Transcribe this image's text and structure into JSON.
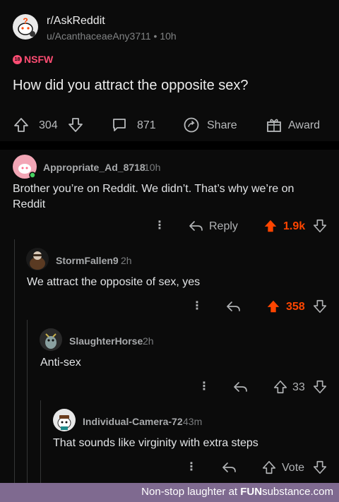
{
  "post": {
    "subreddit": "r/AskReddit",
    "author_meta": "u/AcanthaceaeAny3711 • 10h",
    "nsfw_label": "NSFW",
    "nsfw_badge": "18",
    "title": "How did you attract the opposite sex?",
    "votes": "304",
    "comments": "871",
    "share_label": "Share",
    "award_label": "Award"
  },
  "comments": [
    {
      "user": "Appropriate_Ad_8718",
      "time": "10h",
      "body": "Brother you’re on Reddit. We didn’t. That’s why we’re on Reddit",
      "reply_label": "Reply",
      "score": "1.9k"
    },
    {
      "user": "StormFallen9",
      "time": "2h",
      "body": "We attract the opposite of sex, yes",
      "score": "358"
    },
    {
      "user": "SlaughterHorse",
      "time": "2h",
      "body": "Anti-sex",
      "score": "33"
    },
    {
      "user": "Individual-Camera-72",
      "time": "43m",
      "body": "That sounds like virginity with extra steps",
      "score": "Vote"
    }
  ],
  "footer": {
    "text_prefix": "Non-stop laughter at ",
    "brand_fun": "FUN",
    "brand_rest": "substance",
    "brand_tld": ".com"
  },
  "colors": {
    "accent_upvote": "#ff4500",
    "nsfw": "#ff4d73",
    "footer_bg": "#7f6a90"
  }
}
